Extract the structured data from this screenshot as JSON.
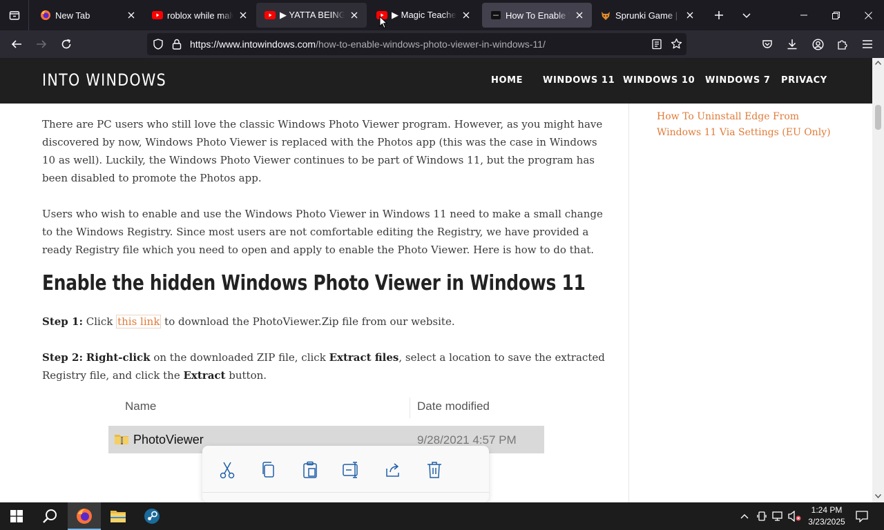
{
  "browser": {
    "tabs": [
      {
        "title": "New Tab",
        "icon": "firefox-icon",
        "selected": false
      },
      {
        "title": "roblox while malware",
        "icon": "youtube-icon",
        "selected": false
      },
      {
        "title": "▶ YATTA BEING CA",
        "icon": "youtube-icon",
        "selected": false
      },
      {
        "title": "▶ Magic Teaches Yo",
        "icon": "youtube-icon",
        "selected": false
      },
      {
        "title": "How To Enable Windo",
        "icon": "intowindows-favicon",
        "selected": true
      },
      {
        "title": "Sprunki Game | Play",
        "icon": "sprunki-icon",
        "selected": false
      }
    ],
    "url_host": "https://www.intowindows.com",
    "url_path": "/how-to-enable-windows-photo-viewer-in-windows-11/"
  },
  "site": {
    "title": "INTO WINDOWS",
    "menu": [
      "HOME",
      "WINDOWS 11",
      "WINDOWS 10",
      "WINDOWS 7",
      "PRIVACY"
    ]
  },
  "article": {
    "para1": "There are PC users who still love the classic Windows Photo Viewer program. However, as you might have discovered by now, Windows Photo Viewer is replaced with the Photos app (this was the case in Windows 10 as well). Luckily, the Windows Photo Viewer continues to be part of Windows 11, but the program has been disabled to promote the Photos app.",
    "para2": "Users who wish to enable and use the Windows Photo Viewer in Windows 11 need to make a small change to the Windows Registry. Since most users are not comfortable editing the Registry, we have provided a ready Registry file which you need to open and apply to enable the Photo Viewer. Here is how to do that.",
    "heading": "Enable the hidden Windows Photo Viewer in Windows 11",
    "step1": {
      "label": "Step 1:",
      "pre": " Click ",
      "link": "this link",
      "post": " to download the PhotoViewer.Zip file from our website."
    },
    "step2": {
      "label": "Step 2:",
      "bold1": "Right-click",
      "t1": " on the downloaded ZIP file, click ",
      "bold2": "Extract files",
      "t2": ", select a location to save the extracted Registry file, and click the ",
      "bold3": "Extract",
      "t3": " button."
    }
  },
  "sidebar": {
    "link": "How To Uninstall Edge From Windows 11 Via Settings (EU Only)"
  },
  "explorer_shot": {
    "col_name": "Name",
    "col_date": "Date modified",
    "file_name": "PhotoViewer",
    "file_date": "9/28/2021 4:57 PM"
  },
  "taskbar": {
    "time": "1:24 PM",
    "date": "3/23/2025"
  },
  "colors": {
    "accent_link": "#e07b39",
    "header_bg": "#1f1f1f",
    "tab_selected": "#42414d"
  }
}
